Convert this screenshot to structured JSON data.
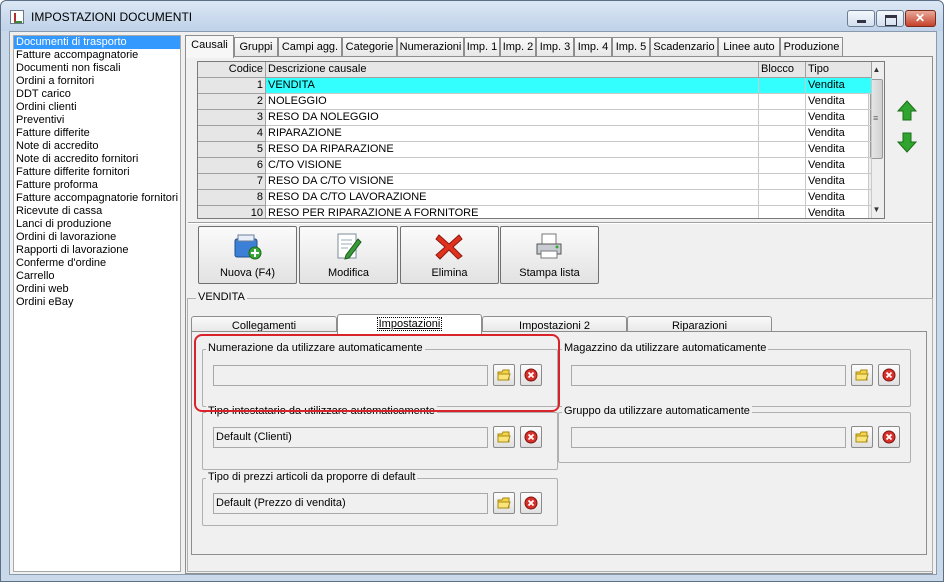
{
  "window": {
    "title": "IMPOSTAZIONI DOCUMENTI"
  },
  "doc_list": [
    "Documenti di trasporto",
    "Fatture accompagnatorie",
    "Documenti non fiscali",
    "Ordini a fornitori",
    "DDT carico",
    "Ordini clienti",
    "Preventivi",
    "Fatture differite",
    "Note di accredito",
    "Note di accredito fornitori",
    "Fatture differite fornitori",
    "Fatture proforma",
    "Fatture accompagnatorie fornitori",
    "Ricevute di cassa",
    "Lanci di produzione",
    "Ordini di lavorazione",
    "Rapporti di lavorazione",
    "Conferme d'ordine",
    "Carrello",
    "Ordini web",
    "Ordini eBay"
  ],
  "doc_list_selected": 0,
  "tabs": [
    "Causali",
    "Gruppi",
    "Campi agg.",
    "Categorie",
    "Numerazioni",
    "Imp. 1",
    "Imp. 2",
    "Imp. 3",
    "Imp. 4",
    "Imp. 5",
    "Scadenzario",
    "Linee auto",
    "Produzione"
  ],
  "active_tab": 0,
  "grid": {
    "headers": [
      "Codice",
      "Descrizione causale",
      "Blocco",
      "Tipo"
    ],
    "rows": [
      {
        "code": "1",
        "desc": "VENDITA",
        "blocco": "",
        "tipo": "Vendita"
      },
      {
        "code": "2",
        "desc": "NOLEGGIO",
        "blocco": "",
        "tipo": "Vendita"
      },
      {
        "code": "3",
        "desc": "RESO DA NOLEGGIO",
        "blocco": "",
        "tipo": "Vendita"
      },
      {
        "code": "4",
        "desc": "RIPARAZIONE",
        "blocco": "",
        "tipo": "Vendita"
      },
      {
        "code": "5",
        "desc": "RESO DA RIPARAZIONE",
        "blocco": "",
        "tipo": "Vendita"
      },
      {
        "code": "6",
        "desc": "C/TO VISIONE",
        "blocco": "",
        "tipo": "Vendita"
      },
      {
        "code": "7",
        "desc": "RESO DA C/TO VISIONE",
        "blocco": "",
        "tipo": "Vendita"
      },
      {
        "code": "8",
        "desc": "RESO DA C/TO LAVORAZIONE",
        "blocco": "",
        "tipo": "Vendita"
      },
      {
        "code": "10",
        "desc": "RESO PER RIPARAZIONE A FORNITORE",
        "blocco": "",
        "tipo": "Vendita"
      }
    ],
    "selected_row": 0
  },
  "toolbar": {
    "new": "Nuova (F4)",
    "edit": "Modifica",
    "delete": "Elimina",
    "print": "Stampa lista"
  },
  "details": {
    "group_title": "VENDITA",
    "subtabs": [
      "Collegamenti",
      "Impostazioni",
      "Impostazioni 2",
      "Riparazioni"
    ],
    "active_subtab": 1,
    "fields": {
      "numerazione": {
        "label": "Numerazione da utilizzare automaticamente",
        "value": ""
      },
      "magazzino": {
        "label": "Magazzino da utilizzare automaticamente",
        "value": ""
      },
      "tipo_intestatario": {
        "label": "Tipo intestatario da utilizzare automaticamente",
        "value": "Default (Clienti)"
      },
      "gruppo": {
        "label": "Gruppo da utilizzare automaticamente",
        "value": ""
      },
      "tipo_prezzi": {
        "label": "Tipo di prezzi articoli da proporre di default",
        "value": "Default (Prezzo di vendita)"
      }
    }
  },
  "colors": {
    "selection_blue": "#3399ff",
    "row_highlight": "#33ffff",
    "annotation_red": "#d9232b",
    "arrow_green": "#2fa52f"
  },
  "icons": {
    "new": "new-document-icon",
    "edit": "edit-pencil-icon",
    "delete": "red-x-icon",
    "print": "printer-icon",
    "browse": "folder-icon",
    "clear": "clear-red-icon",
    "move_up": "green-up-arrow-icon",
    "move_down": "green-down-arrow-icon"
  }
}
